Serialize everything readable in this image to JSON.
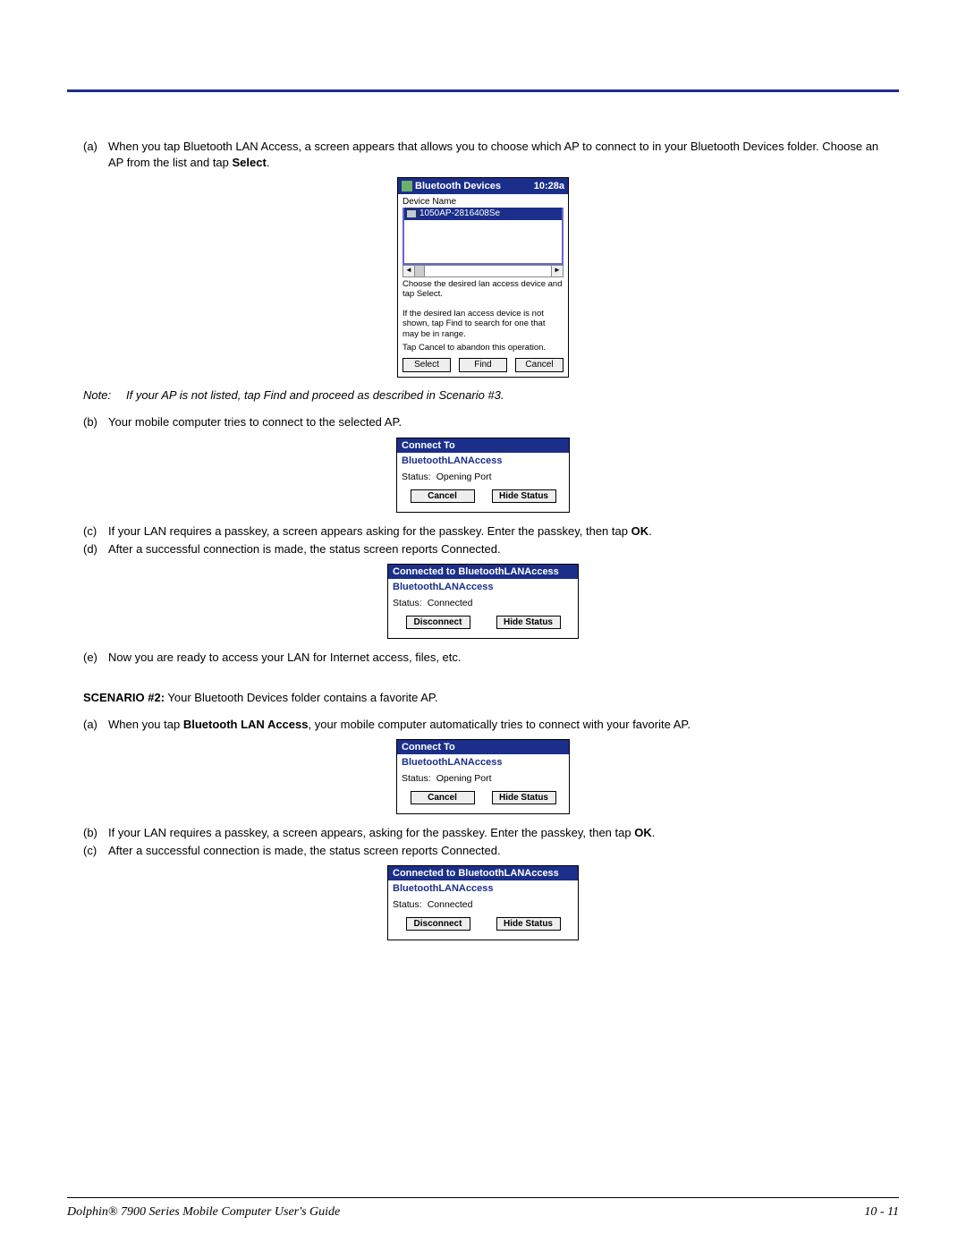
{
  "list": {
    "a1": {
      "marker": "(a)",
      "text_pre": "When you tap Bluetooth LAN Access, a screen appears that allows you to choose which AP to connect to in your Bluetooth Devices folder. Choose an AP from the list and tap ",
      "bold": "Select",
      "text_post": "."
    },
    "b1": {
      "marker": "(b)",
      "text": "Your mobile computer tries to connect to the selected AP."
    },
    "c1": {
      "marker": "(c)",
      "text_pre": "If your LAN requires a passkey, a screen appears asking for the passkey. Enter the passkey, then tap ",
      "bold": "OK",
      "text_post": "."
    },
    "d1": {
      "marker": "(d)",
      "text": "After a successful connection is made, the status screen reports Connected."
    },
    "e1": {
      "marker": "(e)",
      "text": "Now you are ready to access your LAN for Internet access, files, etc."
    },
    "a2": {
      "marker": "(a)",
      "text_pre": "When you tap ",
      "bold": "Bluetooth LAN Access",
      "text_post": ", your mobile computer automatically tries to connect with your favorite AP."
    },
    "b2": {
      "marker": "(b)",
      "text_pre": "If your LAN requires a passkey, a screen appears, asking for the passkey. Enter the passkey, then tap ",
      "bold": "OK",
      "text_post": "."
    },
    "c2": {
      "marker": "(c)",
      "text": "After a successful connection is made, the status screen reports Connected."
    }
  },
  "note": {
    "label": "Note:",
    "text": "If your AP is not listed, tap Find and proceed as described in Scenario #3."
  },
  "scenario2": {
    "bold": "SCENARIO #2:",
    "text": " Your Bluetooth Devices folder contains a favorite AP."
  },
  "bt_dev_screen": {
    "title": "Bluetooth Devices",
    "clock": "10:28a",
    "column": "Device Name",
    "row": "1050AP-2816408Se",
    "msg1": "Choose the desired lan access device and tap Select.",
    "msg2": "If the desired lan access device is not shown, tap Find to search for one that may be in range.",
    "msg3": "Tap Cancel to abandon this operation.",
    "btn_select": "Select",
    "btn_find": "Find",
    "btn_cancel": "Cancel",
    "scroll_left": "◄",
    "scroll_right": "►"
  },
  "connect_open": {
    "title": "Connect To",
    "sub": "BluetoothLANAccess",
    "status_lbl": "Status:",
    "status_val": "Opening Port",
    "btn_cancel": "Cancel",
    "btn_hide": "Hide Status"
  },
  "connected": {
    "title": "Connected to BluetoothLANAccess",
    "sub": "BluetoothLANAccess",
    "status_lbl": "Status:",
    "status_val": "Connected",
    "btn_disc": "Disconnect",
    "btn_hide": "Hide Status"
  },
  "footer": {
    "left": "Dolphin® 7900 Series Mobile Computer User's Guide",
    "right": "10 - 11"
  }
}
